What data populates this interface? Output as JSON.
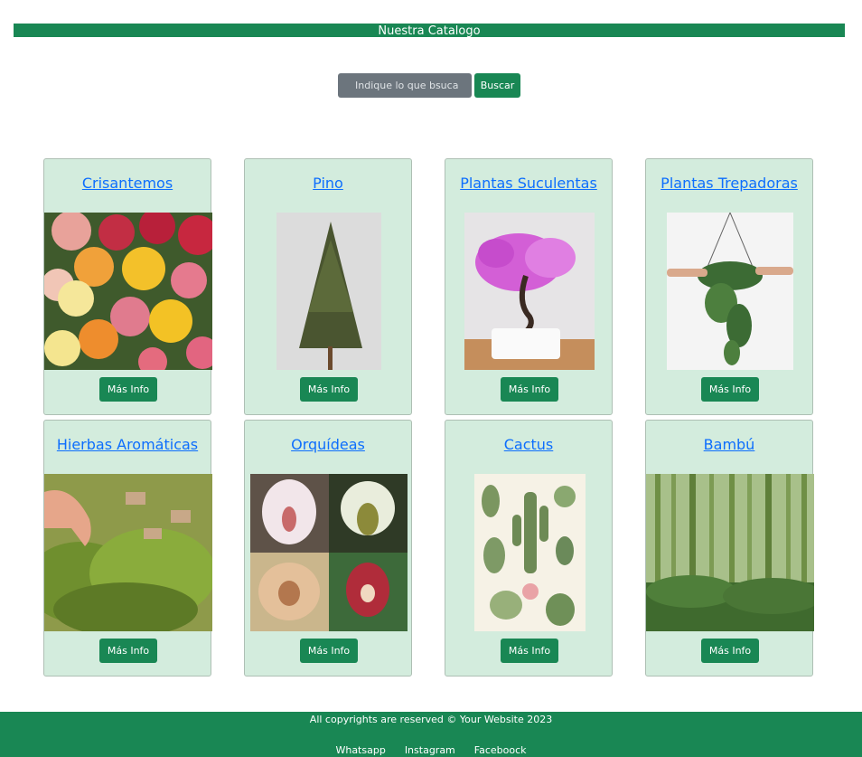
{
  "header": {
    "title": "Nuestra Catalogo"
  },
  "search": {
    "placeholder": "Indique lo que bsuca",
    "button_label": "Buscar"
  },
  "cards": [
    {
      "title": "Crisantemos",
      "button_label": "Más Info"
    },
    {
      "title": "Pino",
      "button_label": "Más Info"
    },
    {
      "title": "Plantas Suculentas",
      "button_label": "Más Info"
    },
    {
      "title": "Plantas Trepadoras",
      "button_label": "Más Info"
    },
    {
      "title": "Hierbas Aromáticas",
      "button_label": "Más Info"
    },
    {
      "title": "Orquídeas",
      "button_label": "Más Info"
    },
    {
      "title": "Cactus",
      "button_label": "Más Info"
    },
    {
      "title": "Bambú",
      "button_label": "Más Info"
    }
  ],
  "footer": {
    "copyright": "All copyrights are reserved © Your Website 2023",
    "links": [
      "Whatsapp",
      "Instagram",
      "Faceboock"
    ]
  },
  "colors": {
    "primary": "#198754",
    "link": "#0d6efd",
    "card_bg": "#d3ecdd",
    "input_bg": "#6c757d"
  }
}
